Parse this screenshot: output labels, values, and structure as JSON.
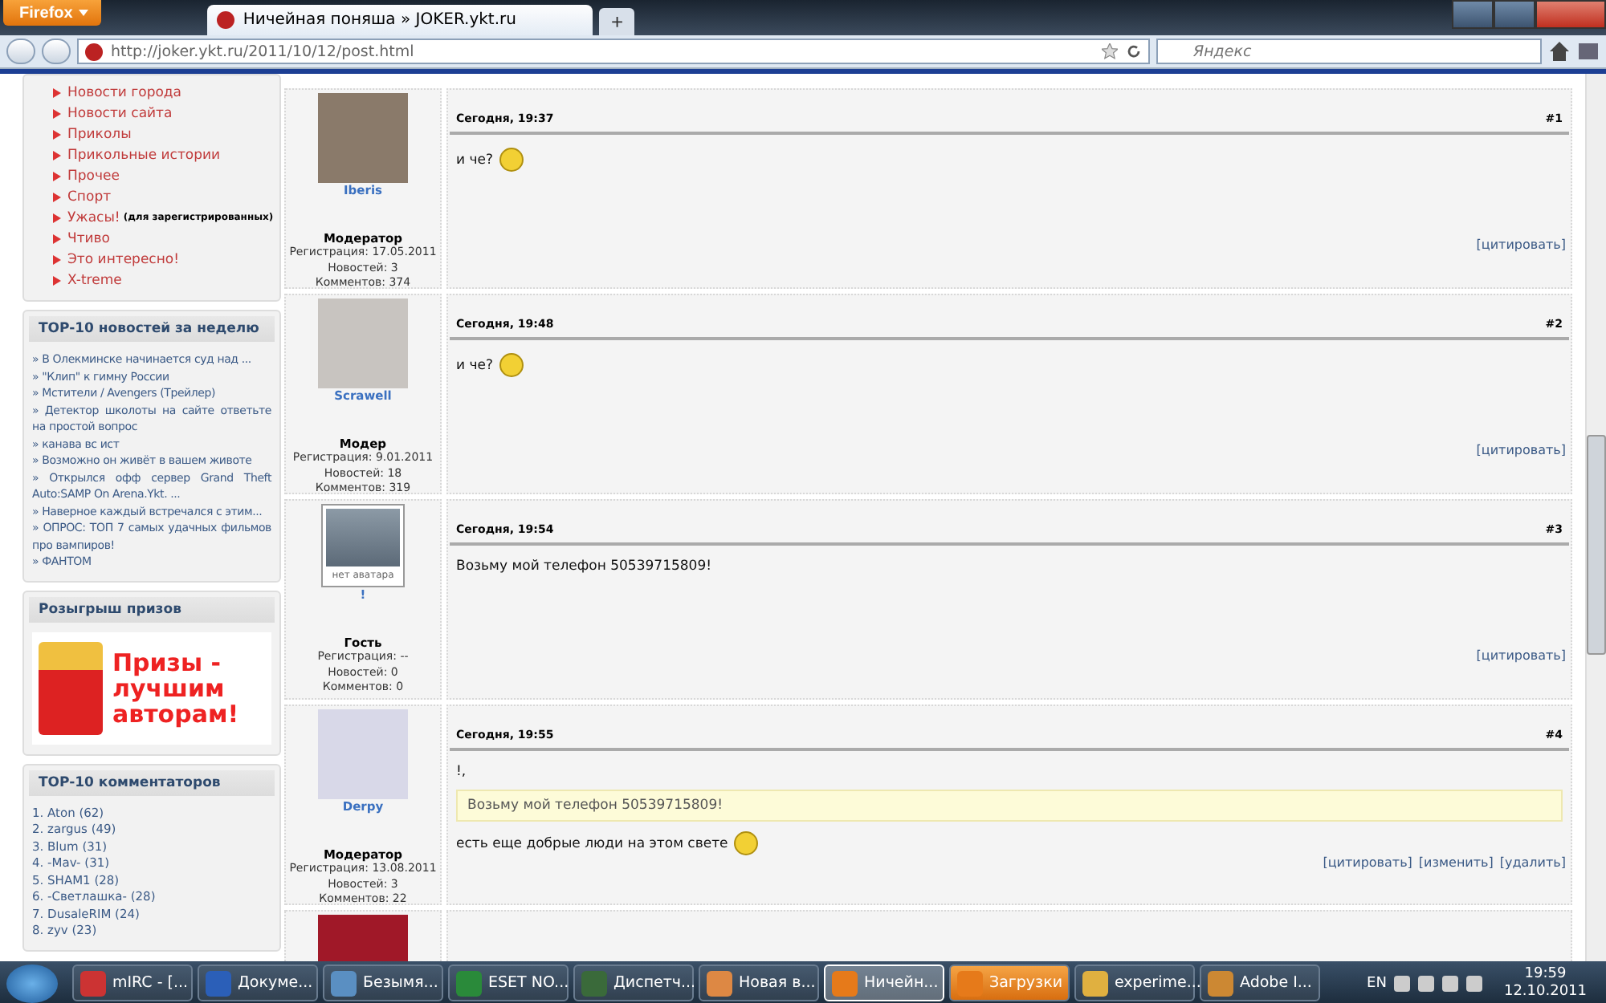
{
  "browser": {
    "menu_button": "Firefox",
    "tabs": [
      {
        "title": "Ничейная поняша » JOKER.ykt.ru",
        "selected": true
      }
    ],
    "new_tab": "+",
    "url": "http://joker.ykt.ru/2011/10/12/post.html",
    "search": {
      "placeholder": "Яндекс"
    }
  },
  "sidebar": {
    "menu": [
      {
        "label": "Новости города"
      },
      {
        "label": "Новости сайта"
      },
      {
        "label": "Приколы"
      },
      {
        "label": "Прикольные истории"
      },
      {
        "label": "Прочее"
      },
      {
        "label": "Спорт"
      },
      {
        "label": "Ужасы!",
        "note": "(для зарегистрированных)"
      },
      {
        "label": "Чтиво"
      },
      {
        "label": "Это интересно!"
      },
      {
        "label": "X-treme"
      }
    ],
    "top_news": {
      "title": "TOP-10 новостей за неделю",
      "items": [
        "» В Олекминске начинается суд над ...",
        "» \"Клип\" к гимну России",
        "» Мстители / Avengers (Трейлер)",
        "» Детектор школоты на сайте ответьте на простой вопрос",
        "» канава вс ист",
        "» Возможно он живёт в вашем животе",
        "» Открылся офф сервер Grand Theft Auto:SAMP On Arena.Ykt. ...",
        "» Наверное каждый встречался с этим...",
        "» ОПРОС: ТОП 7 самых удачных фильмов про вампиров!",
        "» ФАНТОМ"
      ]
    },
    "prizes": {
      "title": "Розыгрыш призов",
      "banner_text": "Призы - лучшим авторам!"
    },
    "top_commenters": {
      "title": "TOP-10 комментаторов",
      "items": [
        "1. Aton (62)",
        "2. zargus (49)",
        "3. Blum (31)",
        "4. -Mav- (31)",
        "5. SHAM1 (28)",
        "6. -Светлашка- (28)",
        "7. DusaleRIM (24)",
        "8. zyv (23)"
      ]
    }
  },
  "posts": [
    {
      "author": "Iberis",
      "has_avatar": true,
      "role": "Модератор",
      "registration": "Регистрация: 17.05.2011",
      "news": "Новостей: 3",
      "comments": "Комментов: 374",
      "date": "Сегодня, 19:37",
      "number": "#1",
      "body": [
        {
          "kind": "text",
          "text": "и че?",
          "emoticon": true
        }
      ],
      "actions": [
        "[цитировать]"
      ]
    },
    {
      "author": "Scrawell",
      "has_avatar": true,
      "role": "Модер",
      "registration": "Регистрация: 9.01.2011",
      "news": "Новостей: 18",
      "comments": "Комментов: 319",
      "date": "Сегодня, 19:48",
      "number": "#2",
      "body": [
        {
          "kind": "text",
          "text": "и че?",
          "emoticon": true
        }
      ],
      "actions": [
        "[цитировать]"
      ]
    },
    {
      "author": "!",
      "has_avatar": false,
      "avatar_caption": "нет аватара",
      "role": "Гость",
      "registration": "Регистрация: --",
      "news": "Новостей: 0",
      "comments": "Комментов: 0",
      "date": "Сегодня, 19:54",
      "number": "#3",
      "body": [
        {
          "kind": "text",
          "text": "Возьму мой телефон 50539715809!"
        }
      ],
      "actions": [
        "[цитировать]"
      ]
    },
    {
      "author": "Derpy",
      "has_avatar": true,
      "role": "Модератор",
      "registration": "Регистрация: 13.08.2011",
      "news": "Новостей: 3",
      "comments": "Комментов: 22",
      "date": "Сегодня, 19:55",
      "number": "#4",
      "body": [
        {
          "kind": "text",
          "text": "!,"
        },
        {
          "kind": "quote",
          "text": "Возьму мой телефон 50539715809!"
        },
        {
          "kind": "text",
          "text": "есть еще добрые люди на этом свете",
          "emoticon": true
        }
      ],
      "actions": [
        "[цитировать]",
        "[изменить]",
        "[удалить]"
      ]
    }
  ],
  "taskbar": {
    "items": [
      {
        "label": "mIRC - [...",
        "selected": false
      },
      {
        "label": "Докуме...",
        "selected": false
      },
      {
        "label": "Безымя...",
        "selected": false
      },
      {
        "label": "ESET NO...",
        "selected": false
      },
      {
        "label": "Диспетч...",
        "selected": false
      },
      {
        "label": "Новая в...",
        "selected": false
      },
      {
        "label": "Ничейн...",
        "selected": true
      },
      {
        "label": "Загрузки",
        "selected": false,
        "flashing": true
      },
      {
        "label": "experime...",
        "selected": false
      },
      {
        "label": "Adobe I...",
        "selected": false
      }
    ],
    "language": "EN",
    "time": "19:59",
    "date": "12.10.2011"
  }
}
